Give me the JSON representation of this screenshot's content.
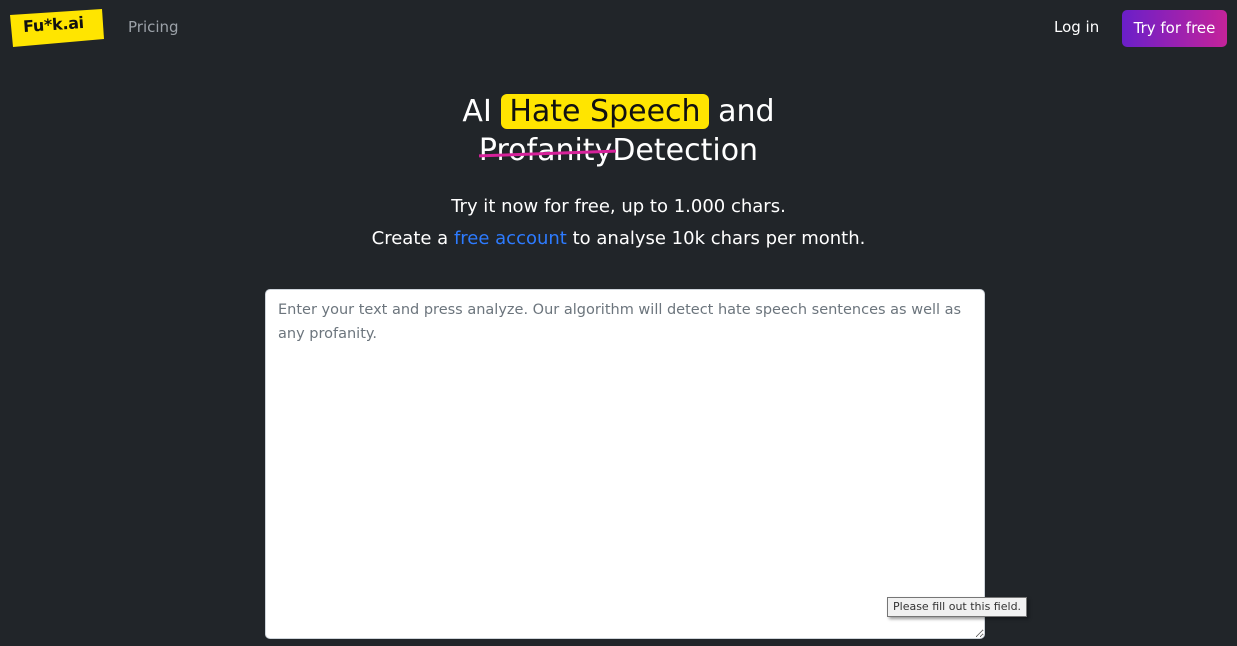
{
  "nav": {
    "logo_text": "Fu*k.ai",
    "pricing": "Pricing",
    "login": "Log in",
    "try_free": "Try for free"
  },
  "hero": {
    "title_prefix": "AI",
    "title_highlight": "Hate Speech",
    "title_suffix": "and",
    "title_struck": "Profanity",
    "title_end": "Detection",
    "sub_line1": "Try it now for free, up to 1.000 chars.",
    "sub_line2_prefix": "Create a",
    "sub_line2_link": "free account",
    "sub_line2_suffix": "to analyse 10k chars per month."
  },
  "analyzer": {
    "placeholder": "Enter your text and press analyze. Our algorithm will detect hate speech sentences as well as any profanity.",
    "value": "",
    "validation_tooltip": "Please fill out this field."
  },
  "colors": {
    "background": "#212529",
    "logo_yellow": "#ffe500",
    "highlight_yellow": "#ffe500",
    "strike_pink": "#d6229a",
    "link_blue": "#2d7bff",
    "button_gradient_start": "#6a1fc9",
    "button_gradient_end": "#c5239a"
  }
}
